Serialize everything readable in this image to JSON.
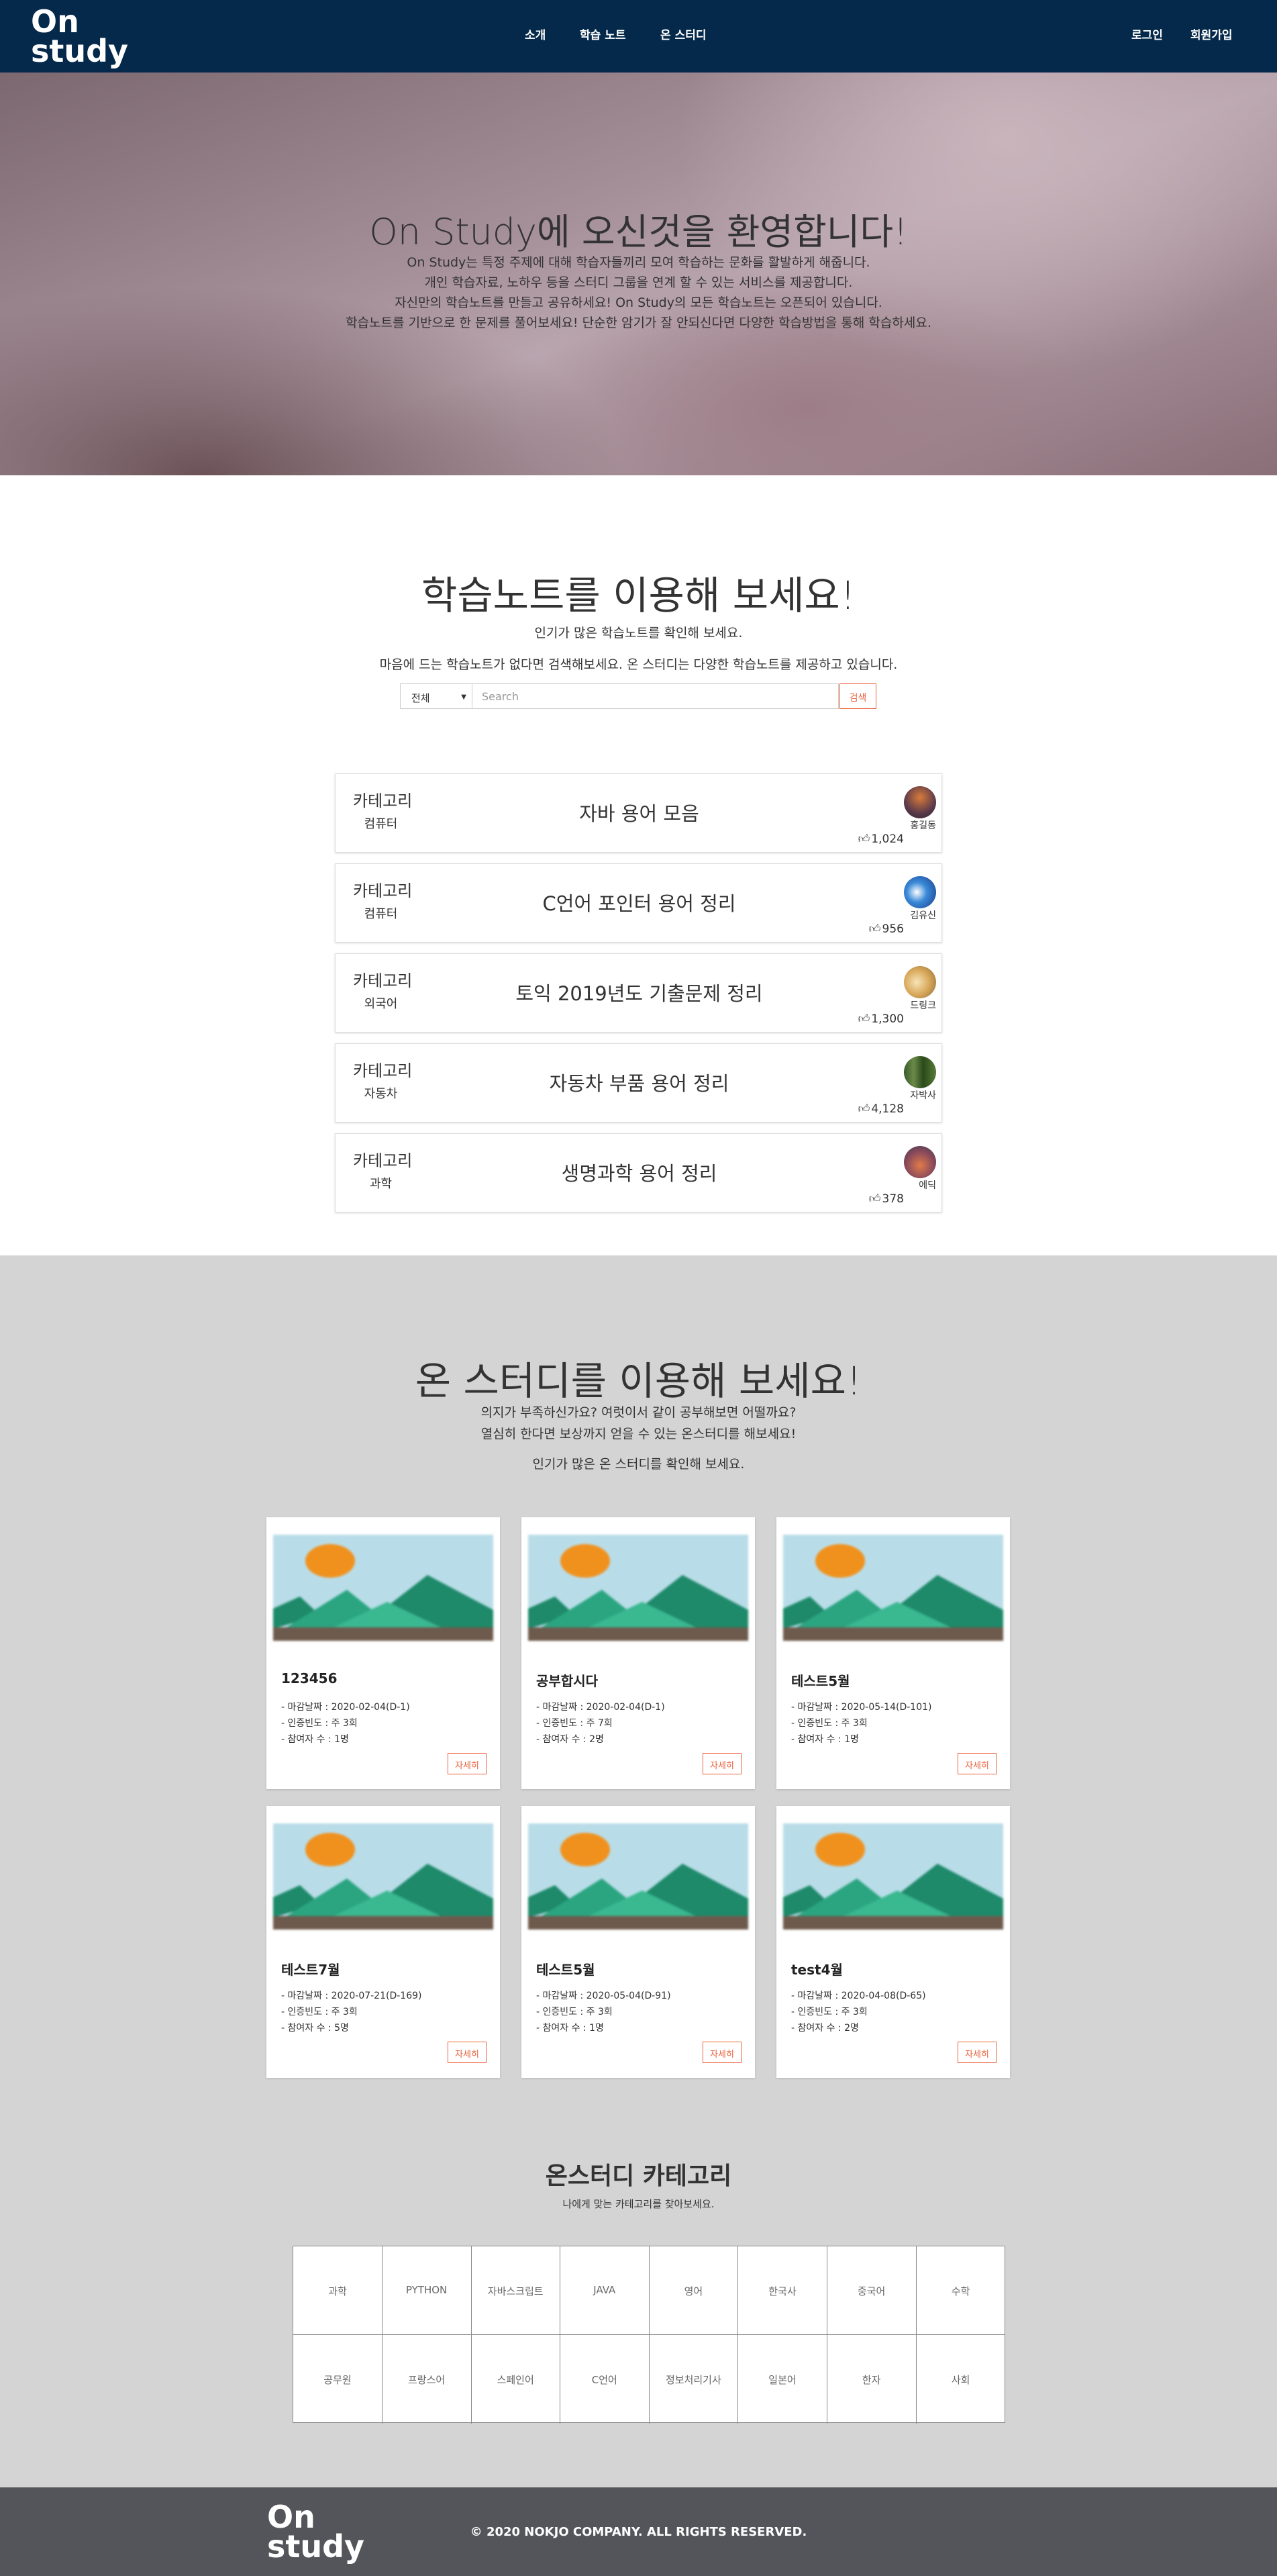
{
  "nav": {
    "logo_line1": "On",
    "logo_line2": "study",
    "menu": [
      "소개",
      "학습 노트",
      "온 스터디"
    ],
    "login": "로그인",
    "signup": "회원가입"
  },
  "hero": {
    "title": "On Study에 오신것을 환영합니다!",
    "lines": [
      "On Study는 특정 주제에 대해 학습자들끼리 모여 학습하는 문화를 활발하게 해줍니다.",
      "개인 학습자료, 노하우 등을 스터디 그룹을 연계 할 수 있는 서비스를 제공합니다.",
      "자신만의 학습노트를 만들고 공유하세요! On Study의 모든 학습노트는 오픈되어 있습니다.",
      "학습노트를 기반으로 한 문제를 풀어보세요! 단순한 암기가 잘 안되신다면 다양한 학습방법을 통해 학습하세요."
    ]
  },
  "notes": {
    "title": "학습노트를 이용해 보세요!",
    "sub1": "인기가 많은 학습노트를 확인해 보세요.",
    "sub2": "마음에 드는 학습노트가 없다면 검색해보세요. 온 스터디는 다양한 학습노트를 제공하고 있습니다.",
    "search": {
      "select": "전체",
      "placeholder": "Search",
      "button": "검색"
    },
    "category_label": "카테고리",
    "items": [
      {
        "category": "컴퓨터",
        "title": "자바 용어 모음",
        "author": "홍길동",
        "likes": "1,024"
      },
      {
        "category": "컴퓨터",
        "title": "C언어 포인터 용어 정리",
        "author": "김유신",
        "likes": "956"
      },
      {
        "category": "외국어",
        "title": "토익 2019년도 기출문제 정리",
        "author": "드링크",
        "likes": "1,300"
      },
      {
        "category": "자동차",
        "title": "자동차 부품 용어 정리",
        "author": "자박사",
        "likes": "4,128"
      },
      {
        "category": "과학",
        "title": "생명과학 용어 정리",
        "author": "에딕",
        "likes": "378"
      }
    ]
  },
  "study": {
    "title": "온 스터디를 이용해 보세요!",
    "sub1": "의지가 부족하신가요? 여럿이서 같이 공부해보면 어떨까요?",
    "sub2": "열심히 한다면 보상까지 얻을 수 있는 온스터디를 해보세요!",
    "sub3": "인기가 많은 온 스터디를 확인해 보세요.",
    "detail_button": "자세히",
    "cards": [
      {
        "title": "123456",
        "deadline": "- 마감날짜 : 2020-02-04(D-1)",
        "freq": "- 인증빈도 : 주 3회",
        "members": "- 참여자 수 : 1명"
      },
      {
        "title": "공부합시다",
        "deadline": "- 마감날짜 : 2020-02-04(D-1)",
        "freq": "- 인증빈도 : 주 7회",
        "members": "- 참여자 수 : 2명"
      },
      {
        "title": "테스트5월",
        "deadline": "- 마감날짜 : 2020-05-14(D-101)",
        "freq": "- 인증빈도 : 주 3회",
        "members": "- 참여자 수 : 1명"
      },
      {
        "title": "테스트7월",
        "deadline": "- 마감날짜 : 2020-07-21(D-169)",
        "freq": "- 인증빈도 : 주 3회",
        "members": "- 참여자 수 : 5명"
      },
      {
        "title": "테스트5월",
        "deadline": "- 마감날짜 : 2020-05-04(D-91)",
        "freq": "- 인증빈도 : 주 3회",
        "members": "- 참여자 수 : 1명"
      },
      {
        "title": "test4월",
        "deadline": "- 마감날짜 : 2020-04-08(D-65)",
        "freq": "- 인증빈도 : 주 3회",
        "members": "- 참여자 수 : 2명"
      }
    ]
  },
  "categories": {
    "title": "온스터디 카테고리",
    "sub": "나에게 맞는 카테고리를 찾아보세요.",
    "items": [
      "과학",
      "PYTHON",
      "자바스크립트",
      "JAVA",
      "영어",
      "한국사",
      "중국어",
      "수학",
      "공무원",
      "프랑스어",
      "스페인어",
      "C언어",
      "정보처리기사",
      "일본어",
      "한자",
      "사회"
    ]
  },
  "footer": {
    "copyright": "© 2020 NOKJO COMPANY. ALL RIGHTS RESERVED."
  },
  "colors": {
    "nav_bg": "#05294a",
    "accent": "#e8603c",
    "section_gray": "#d4d4d4",
    "footer_bg": "#54555a"
  }
}
